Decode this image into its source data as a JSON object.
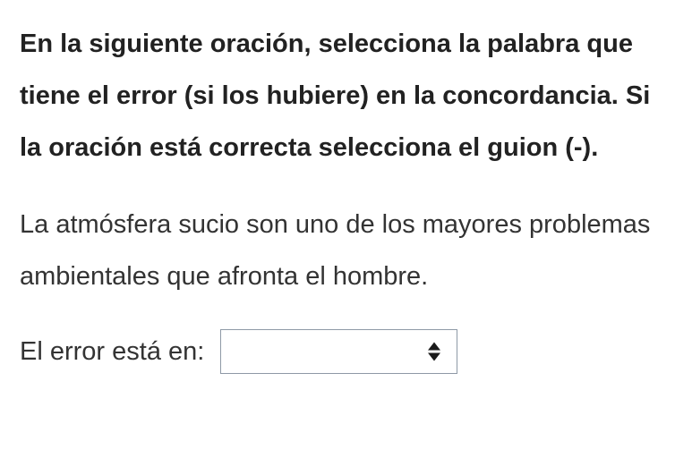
{
  "question": {
    "instructions": "En la siguiente oración, selecciona la palabra que tiene el error (si los hubiere) en la concordancia. Si la oración está correcta selecciona el guion (-).",
    "sentence": "La atmósfera sucio son uno de los mayores problemas ambientales que afronta el hombre.",
    "answer_label": "El error está en:",
    "selected_value": ""
  }
}
